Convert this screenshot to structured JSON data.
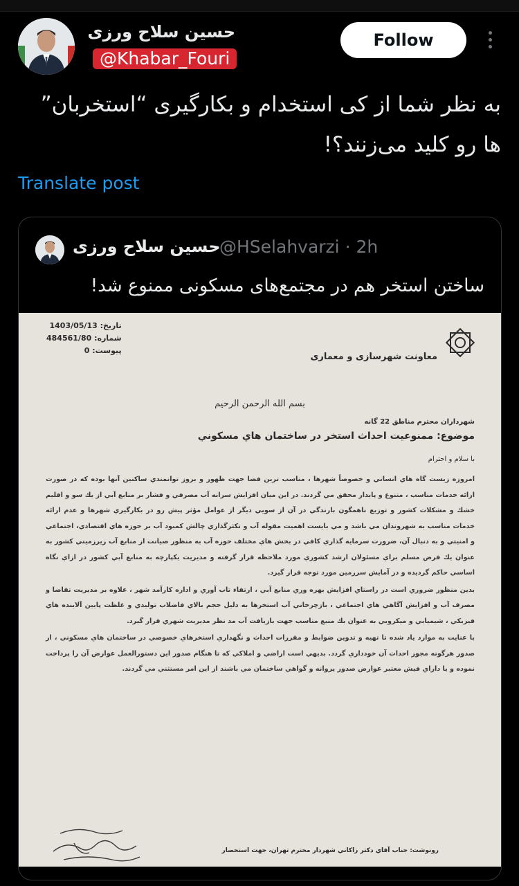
{
  "author": {
    "name": "حسین سلاح ورزی",
    "handle": "@Khabar_Fouri"
  },
  "follow_label": "Follow",
  "tweet_text": "به نظر شما از کی استخدام و بکارگیری “استخربان” ها رو کلید می‌زنند؟!",
  "translate_label": "Translate post",
  "quote": {
    "name": "حسین سلاح ورزی",
    "meta": "@HSelahvarzi · 2h",
    "text": "ساختن استخر هم در مجتمع‌های مسکونی ممنوع شد!"
  },
  "document": {
    "date_line": "تاريخ: 1403/05/13",
    "number_line": "شماره: 484561/80",
    "attachment_line": "پيوست: 0",
    "org": "معاونت شهرسازی و معماری",
    "basmala": "بسم الله الرحمن الرحيم",
    "to": "شهرداران محترم مناطق 22 گانه",
    "subject": "موضوع: ممنوعيت احداث استخر در ساختمان هاي مسكوني",
    "greeting": "با سلام و احترام",
    "paragraphs": [
      "امروزه زيست گاه هاي انساني و خصوصاً شهرها ، مناسب ترين فضا جهت ظهور و بروز توانمندي ساكنين آنها بوده كه در صورت ارائه خدمات مناسب ، متنوع و پايدار محقق مي گردند. در اين ميان افزايش سرانه آب مصرفي و فشار بر منابع آبي از يك سو و اقليم خشك و مشكلات كشور و توزيع ناهمگون بارندگي در آن از سويي ديگر از عوامل مؤثر پيش رو در بكارگيري شهرها و عدم ارائه خدمات مناسب به شهروندان مي باشد و مي بايست اهميت مقوله آب و تكثرگذاري چالش كمبود آب بر حوزه هاي اقتصادي، اجتماعي و امنيتي و به دنبال آن، ضرورت سرمايه گذاري كافي در بخش هاي مختلف حوزه آب به منظور صيانت از منابع آب زيرزميني كشور به عنوان يك فرض مسلم براي مسئولان ارشد كشوري مورد ملاحظه قرار گرفته و مديريت يكپارچه به منابع آبي كشور در ازاي نگاه اساسي حاكم گرديده و در آمايش سرزمين مورد توجه قرار گيرد.",
      "بدين منظور ضروري است در راستاي افزايش بهره وري منابع آبي ، ارتقاء تاب آوري و اداره كارآمد شهر ، علاوه بر مديريت تقاضا و مصرف آب و افزايش آگاهي هاي اجتماعي ، بازچرخاني آب استخرها به دليل حجم بالاي فاضلاب توليدي و غلظت پايين آلاينده هاي فيزيكي ، شيميايي و ميكروبي به عنوان يك منبع مناسب جهت بازيافت آب مد نظر مديريت شهري قرار گيرد.",
      "با عنايت به موارد ياد شده تا تهيه و تدوين ضوابط و مقررات احداث و نگهداري استخرهاي خصوصي در ساختمان هاي مسكوني ، از صدور هرگونه مجوز احداث آن خودداري گردد. بديهي است اراضي و املاكي كه تا هنگام صدور اين دستورالعمل عوارض آن را پرداخت نموده و يا داراي فيش معتبر عوارض صدور پروانه و گواهي ساختمان مي باشند از اين امر مستثني مي گردند."
    ],
    "cc": "رونوشت: جناب آقاي دكتر زاكاني شهردار محترم تهران، جهت استحضار"
  }
}
